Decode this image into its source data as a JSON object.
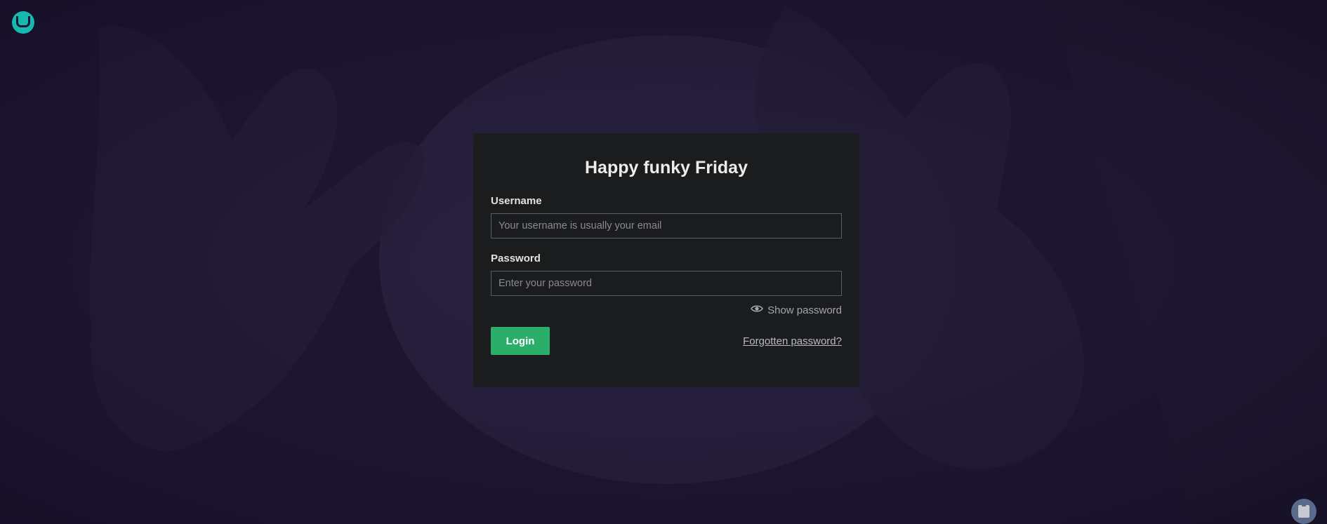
{
  "app": {
    "logo_icon": "umbraco-logo-icon",
    "brand_color": "#16b9b0"
  },
  "login": {
    "greeting": "Happy funky Friday",
    "username_label": "Username",
    "username_placeholder": "Your username is usually your email",
    "username_value": "",
    "password_label": "Password",
    "password_placeholder": "Enter your password",
    "password_value": "",
    "show_password_label": "Show password",
    "show_password_icon": "eye-icon",
    "login_button_label": "Login",
    "forgot_password_label": "Forgotten password?"
  },
  "colors": {
    "background": "#1c1530",
    "panel": "#1b1c1e",
    "login_button": "#2bae6a"
  },
  "help": {
    "icon": "help-clipboard-icon"
  }
}
